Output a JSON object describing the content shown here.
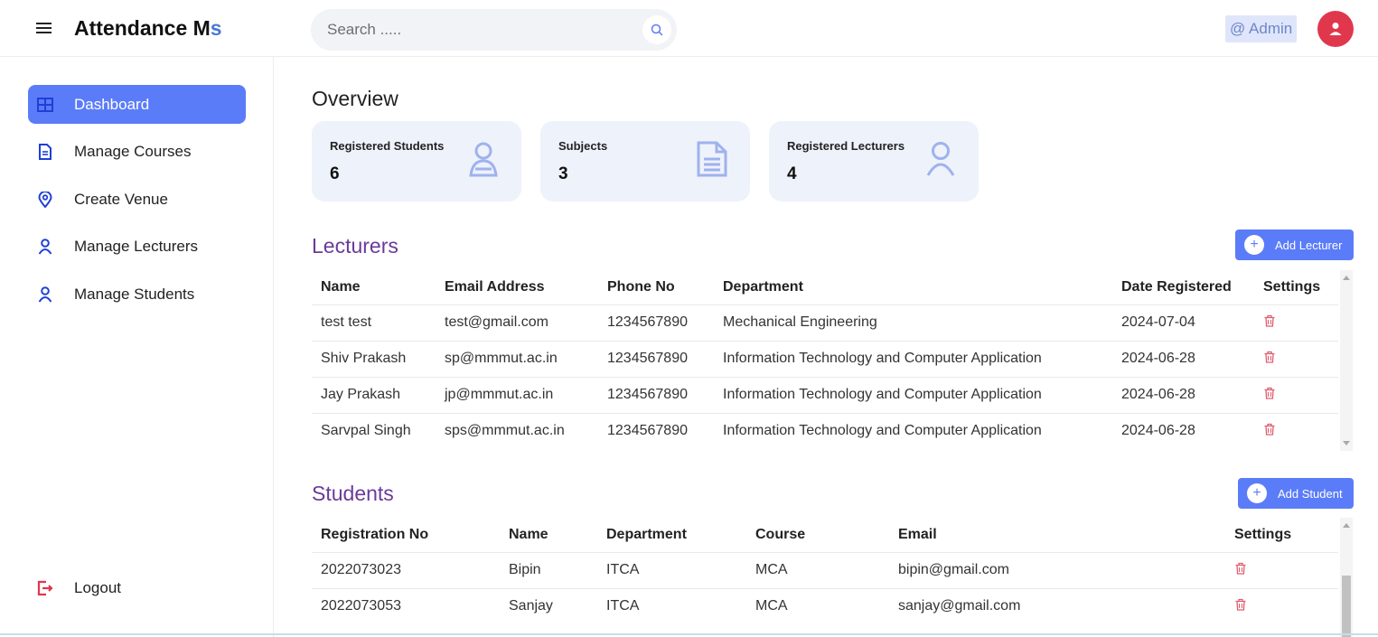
{
  "header": {
    "brand_main": "Attendance M",
    "brand_accent": "s",
    "search_placeholder": "Search .....",
    "admin_label": "@ Admin"
  },
  "sidebar": {
    "items": [
      {
        "label": "Dashboard",
        "icon": "dashboard-grid-icon",
        "active": true
      },
      {
        "label": "Manage Courses",
        "icon": "document-icon"
      },
      {
        "label": "Create Venue",
        "icon": "location-pin-icon"
      },
      {
        "label": "Manage Lecturers",
        "icon": "user-icon"
      },
      {
        "label": "Manage Students",
        "icon": "user-icon"
      }
    ],
    "logout_label": "Logout"
  },
  "overview": {
    "title": "Overview",
    "cards": [
      {
        "label": "Registered Students",
        "value": "6",
        "icon": "student-icon"
      },
      {
        "label": "Subjects",
        "value": "3",
        "icon": "document-icon"
      },
      {
        "label": "Registered Lecturers",
        "value": "4",
        "icon": "user-icon"
      }
    ]
  },
  "lecturers": {
    "title": "Lecturers",
    "add_label": "Add Lecturer",
    "columns": [
      "Name",
      "Email Address",
      "Phone No",
      "Department",
      "Date Registered",
      "Settings"
    ],
    "rows": [
      [
        "test test",
        "test@gmail.com",
        "1234567890",
        "Mechanical Engineering",
        "2024-07-04"
      ],
      [
        "Shiv Prakash",
        "sp@mmmut.ac.in",
        "1234567890",
        "Information Technology and Computer Application",
        "2024-06-28"
      ],
      [
        "Jay Prakash",
        "jp@mmmut.ac.in",
        "1234567890",
        "Information Technology and Computer Application",
        "2024-06-28"
      ],
      [
        "Sarvpal Singh",
        "sps@mmmut.ac.in",
        "1234567890",
        "Information Technology and Computer Application",
        "2024-06-28"
      ]
    ]
  },
  "students": {
    "title": "Students",
    "add_label": "Add Student",
    "columns": [
      "Registration No",
      "Name",
      "Department",
      "Course",
      "Email",
      "Settings"
    ],
    "rows": [
      [
        "2022073023",
        "Bipin",
        "ITCA",
        "MCA",
        "bipin@gmail.com"
      ],
      [
        "2022073053",
        "Sanjay",
        "ITCA",
        "MCA",
        "sanjay@gmail.com"
      ]
    ]
  },
  "colors": {
    "accent": "#5b7cf8",
    "section_title": "#6b3a9a",
    "card_bg": "#eef2fb",
    "danger": "#e0374c",
    "trash": "#e05d6f"
  }
}
